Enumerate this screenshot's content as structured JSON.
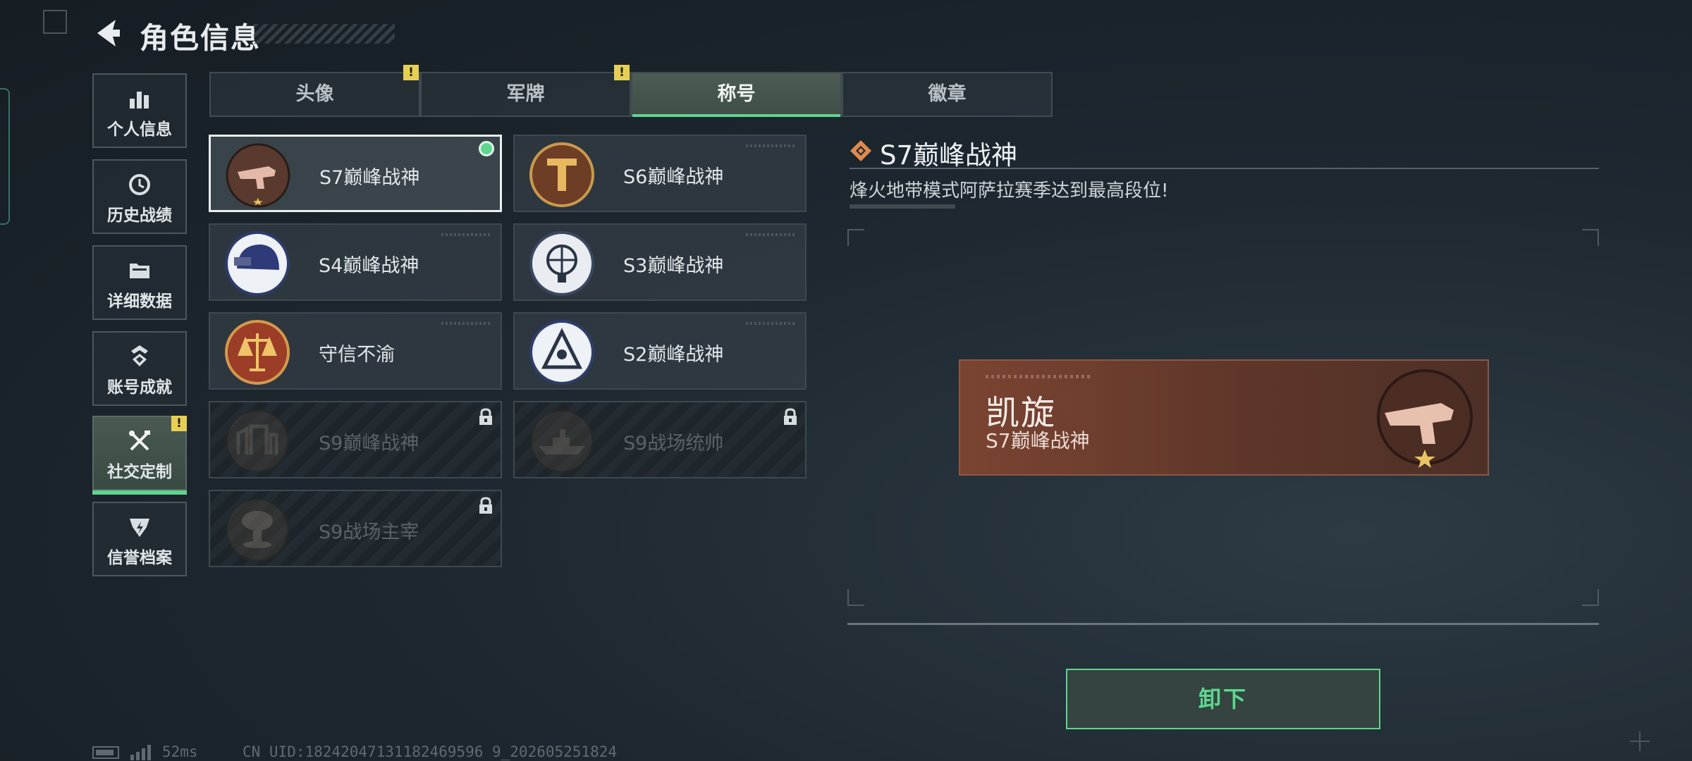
{
  "header": {
    "title": "角色信息"
  },
  "sidebar": {
    "items": [
      {
        "label": "个人信息",
        "icon": "bar-chart-icon"
      },
      {
        "label": "历史战绩",
        "icon": "clock-history-icon"
      },
      {
        "label": "详细数据",
        "icon": "folder-icon"
      },
      {
        "label": "账号成就",
        "icon": "achievement-icon"
      },
      {
        "label": "社交定制",
        "icon": "tools-icon",
        "active": true,
        "alert": "!"
      },
      {
        "label": "信誉档案",
        "icon": "credit-shield-icon"
      }
    ]
  },
  "tabs": [
    {
      "label": "头像",
      "alert": "!"
    },
    {
      "label": "军牌",
      "alert": "!"
    },
    {
      "label": "称号",
      "active": true
    },
    {
      "label": "徽章"
    }
  ],
  "titles": [
    {
      "label": "S7巅峰战神",
      "emblem": "gun-emblem",
      "state": "equipped"
    },
    {
      "label": "S6巅峰战神",
      "emblem": "t-shield-emblem",
      "state": "owned"
    },
    {
      "label": "S4巅峰战神",
      "emblem": "helmet-emblem",
      "state": "owned"
    },
    {
      "label": "S3巅峰战神",
      "emblem": "globe-emblem",
      "state": "owned"
    },
    {
      "label": "守信不渝",
      "emblem": "scales-emblem",
      "state": "owned"
    },
    {
      "label": "S2巅峰战神",
      "emblem": "pyramid-emblem",
      "state": "owned"
    },
    {
      "label": "S9巅峰战神",
      "emblem": "fortress-emblem",
      "state": "locked"
    },
    {
      "label": "S9战场统帅",
      "emblem": "warship-emblem",
      "state": "locked"
    },
    {
      "label": "S9战场主宰",
      "emblem": "mushroom-cloud-emblem",
      "state": "locked"
    }
  ],
  "detail": {
    "title": "S7巅峰战神",
    "description": "烽火地带模式阿萨拉赛季达到最高段位!",
    "preview": {
      "name": "凯旋",
      "subtitle": "S7巅峰战神"
    },
    "unequip_label": "卸下"
  },
  "status": {
    "ping": "52ms",
    "uid": "CN UID:18242047131182469596 9_202605251824"
  },
  "colors": {
    "accent": "#5fd58f",
    "alert": "#e7cf54",
    "preview_bg": "#7b4432"
  }
}
